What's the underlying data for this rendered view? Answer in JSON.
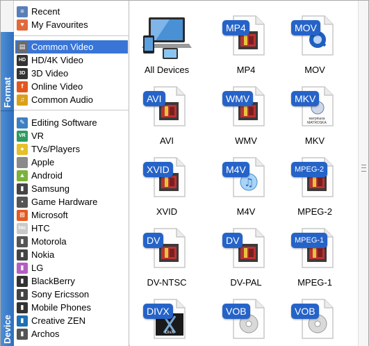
{
  "tabs": {
    "format_label": "Format",
    "device_label": "Device"
  },
  "menu": {
    "top": [
      {
        "label": "Recent",
        "icon": "recent-list-icon"
      },
      {
        "label": "My Favourites",
        "icon": "heart-icon"
      }
    ],
    "format": [
      {
        "label": "Common Video",
        "icon": "film-icon",
        "selected": true
      },
      {
        "label": "HD/4K Video",
        "icon": "hd-icon"
      },
      {
        "label": "3D Video",
        "icon": "3d-icon"
      },
      {
        "label": "Online Video",
        "icon": "online-video-icon"
      },
      {
        "label": "Common Audio",
        "icon": "music-note-icon"
      }
    ],
    "device": [
      {
        "label": "Editing Software",
        "icon": "editing-software-icon"
      },
      {
        "label": "VR",
        "icon": "vr-icon"
      },
      {
        "label": "TVs/Players",
        "icon": "tv-player-icon"
      },
      {
        "label": "Apple",
        "icon": "apple-icon"
      },
      {
        "label": "Android",
        "icon": "android-icon"
      },
      {
        "label": "Samsung",
        "icon": "samsung-phone-icon"
      },
      {
        "label": "Game Hardware",
        "icon": "game-hardware-icon"
      },
      {
        "label": "Microsoft",
        "icon": "microsoft-icon"
      },
      {
        "label": "HTC",
        "icon": "htc-icon"
      },
      {
        "label": "Motorola",
        "icon": "motorola-phone-icon"
      },
      {
        "label": "Nokia",
        "icon": "nokia-phone-icon"
      },
      {
        "label": "LG",
        "icon": "lg-phone-icon"
      },
      {
        "label": "BlackBerry",
        "icon": "blackberry-icon"
      },
      {
        "label": "Sony Ericsson",
        "icon": "sony-ericsson-icon"
      },
      {
        "label": "Mobile Phones",
        "icon": "mobile-phone-icon"
      },
      {
        "label": "Creative ZEN",
        "icon": "creative-zen-icon"
      },
      {
        "label": "Archos",
        "icon": "archos-icon"
      }
    ]
  },
  "formats": [
    {
      "caption": "All Devices",
      "badge": "",
      "kind": "devices"
    },
    {
      "caption": "MP4",
      "badge": "MP4",
      "kind": "film"
    },
    {
      "caption": "MOV",
      "badge": "MOV",
      "kind": "quicktime"
    },
    {
      "caption": "AVI",
      "badge": "AVI",
      "kind": "film"
    },
    {
      "caption": "WMV",
      "badge": "WMV",
      "kind": "film"
    },
    {
      "caption": "MKV",
      "badge": "MKV",
      "kind": "matroska"
    },
    {
      "caption": "XVID",
      "badge": "XVID",
      "kind": "film"
    },
    {
      "caption": "M4V",
      "badge": "M4V",
      "kind": "itunes"
    },
    {
      "caption": "MPEG-2",
      "badge": "MPEG-2",
      "kind": "film"
    },
    {
      "caption": "DV-NTSC",
      "badge": "DV",
      "kind": "film"
    },
    {
      "caption": "DV-PAL",
      "badge": "DV",
      "kind": "film"
    },
    {
      "caption": "MPEG-1",
      "badge": "MPEG-1",
      "kind": "film"
    },
    {
      "caption": "",
      "badge": "DIVX",
      "kind": "divx"
    },
    {
      "caption": "",
      "badge": "VOB",
      "kind": "disc"
    },
    {
      "caption": "",
      "badge": "VOB",
      "kind": "disc"
    }
  ],
  "matroska_text": "матрёшка MATROSKA",
  "divx_text": "DivX",
  "colors": {
    "accent": "#2563c8",
    "selected_row": "#3875d7",
    "tab_blue": "#2d6fbf"
  }
}
